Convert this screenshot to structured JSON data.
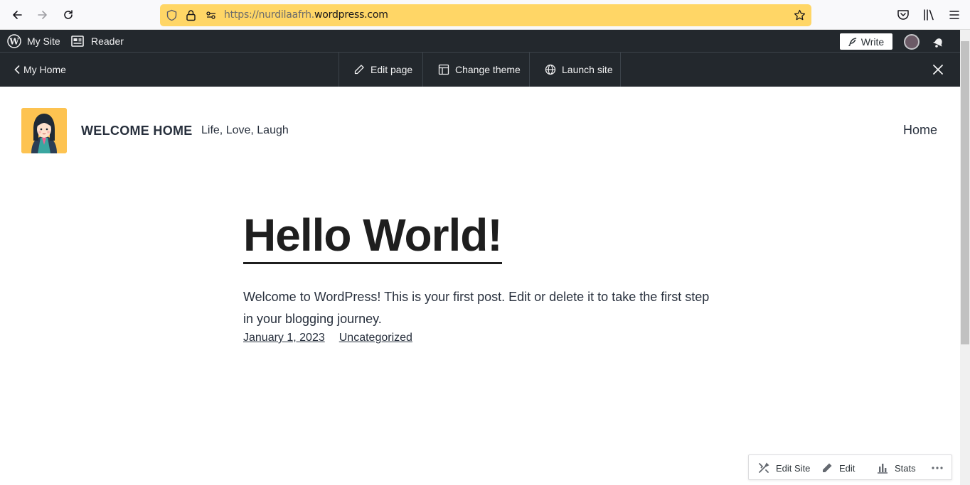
{
  "browser": {
    "url_prefix": "https://nurdilaafrh.",
    "url_domain": "wordpress.com"
  },
  "wp_bar": {
    "my_site": "My Site",
    "reader": "Reader",
    "write": "Write"
  },
  "page_bar": {
    "back_label": "My Home",
    "edit_page": "Edit page",
    "change_theme": "Change theme",
    "launch_site": "Launch site"
  },
  "site": {
    "title": "WELCOME HOME",
    "tagline": "Life, Love, Laugh",
    "nav_home": "Home"
  },
  "post": {
    "title": "Hello World!",
    "body": "Welcome to WordPress! This is your first post. Edit or delete it to take the first step in your blogging journey.",
    "date": "January 1, 2023",
    "category": "Uncategorized"
  },
  "fab": {
    "edit_site": "Edit Site",
    "edit": "Edit",
    "stats": "Stats"
  },
  "colors": {
    "url_bar": "#ffd666",
    "admin_bar": "#23282d",
    "logo_bg": "#fdc351"
  }
}
